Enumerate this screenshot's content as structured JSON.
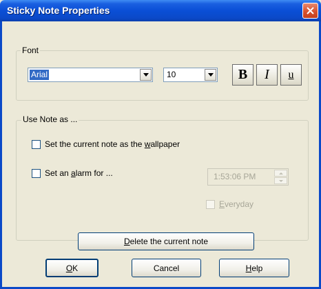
{
  "window": {
    "title": "Sticky Note Properties"
  },
  "font_group": {
    "legend": "Font",
    "font_name": "Arial",
    "font_size": "10",
    "bold_label": "B",
    "italic_label": "I",
    "underline_label": "u"
  },
  "use_group": {
    "legend": "Use Note as ...",
    "wallpaper": {
      "pre": "Set the current note as the ",
      "key": "w",
      "post": "allpaper"
    },
    "alarm": {
      "pre": "Set an ",
      "key": "a",
      "post": "larm for ..."
    },
    "time_value": "1:53:06 PM",
    "everyday": {
      "key": "E",
      "post": "veryday"
    }
  },
  "buttons": {
    "delete": {
      "key": "D",
      "post": "elete the current note"
    },
    "ok": {
      "key": "O",
      "post": "K"
    },
    "cancel": "Cancel",
    "help": {
      "key": "H",
      "post": "elp"
    }
  }
}
